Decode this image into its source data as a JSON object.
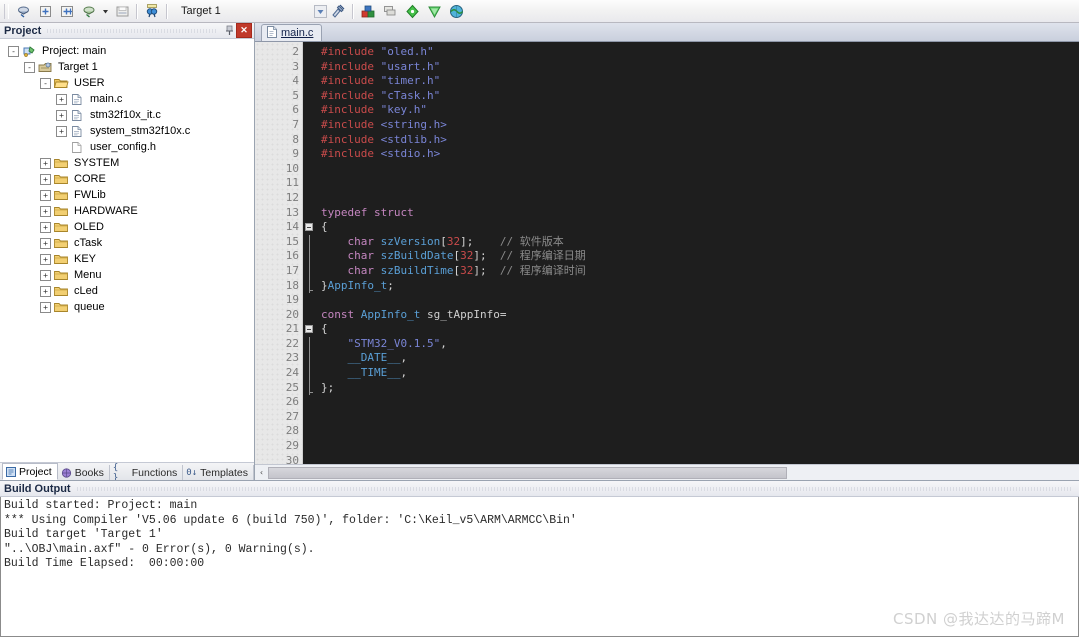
{
  "toolbar": {
    "buttons": [
      {
        "name": "new-file-icon",
        "title": "New"
      },
      {
        "name": "open-file-icon",
        "title": "Open"
      },
      {
        "name": "save-icon",
        "title": "Save"
      },
      {
        "name": "save-all-icon",
        "title": "Save All"
      },
      {
        "name": "print-icon",
        "title": "Print"
      },
      {
        "name": "translate-icon",
        "title": "Translate"
      }
    ],
    "target_value": "Target 1",
    "right_buttons": [
      {
        "name": "target-options-icon",
        "title": "Options for Target"
      },
      {
        "name": "build-icon",
        "title": "Build"
      },
      {
        "name": "rebuild-icon",
        "title": "Rebuild"
      },
      {
        "name": "debug-icon",
        "title": "Start/Stop Debug"
      },
      {
        "name": "bookmark-icon",
        "title": "Bookmark"
      },
      {
        "name": "manage-icon",
        "title": "Manage Run-Time Environment"
      }
    ]
  },
  "project_panel": {
    "title": "Project",
    "pin_label": "⇱",
    "close_label": "✕",
    "tree": [
      {
        "label": "Project: main",
        "indent": 0,
        "expander": "-",
        "icon": "project-icon"
      },
      {
        "label": "Target 1",
        "indent": 1,
        "expander": "-",
        "icon": "target-icon"
      },
      {
        "label": "USER",
        "indent": 2,
        "expander": "-",
        "icon": "folder-open-icon"
      },
      {
        "label": "main.c",
        "indent": 3,
        "expander": "+",
        "icon": "c-file-icon"
      },
      {
        "label": "stm32f10x_it.c",
        "indent": 3,
        "expander": "+",
        "icon": "c-file-icon"
      },
      {
        "label": "system_stm32f10x.c",
        "indent": 3,
        "expander": "+",
        "icon": "c-file-icon"
      },
      {
        "label": "user_config.h",
        "indent": 3,
        "expander": "",
        "icon": "h-file-icon"
      },
      {
        "label": "SYSTEM",
        "indent": 2,
        "expander": "+",
        "icon": "folder-icon"
      },
      {
        "label": "CORE",
        "indent": 2,
        "expander": "+",
        "icon": "folder-icon"
      },
      {
        "label": "FWLib",
        "indent": 2,
        "expander": "+",
        "icon": "folder-icon"
      },
      {
        "label": "HARDWARE",
        "indent": 2,
        "expander": "+",
        "icon": "folder-icon"
      },
      {
        "label": "OLED",
        "indent": 2,
        "expander": "+",
        "icon": "folder-icon"
      },
      {
        "label": "cTask",
        "indent": 2,
        "expander": "+",
        "icon": "folder-icon"
      },
      {
        "label": "KEY",
        "indent": 2,
        "expander": "+",
        "icon": "folder-icon"
      },
      {
        "label": "Menu",
        "indent": 2,
        "expander": "+",
        "icon": "folder-icon"
      },
      {
        "label": "cLed",
        "indent": 2,
        "expander": "+",
        "icon": "folder-icon"
      },
      {
        "label": "queue",
        "indent": 2,
        "expander": "+",
        "icon": "folder-icon"
      }
    ],
    "tabs": [
      {
        "label": "Project",
        "icon": "project-tab-icon",
        "active": true
      },
      {
        "label": "Books",
        "icon": "books-tab-icon",
        "active": false
      },
      {
        "label": "Functions",
        "icon": "functions-tab-icon",
        "active": false
      },
      {
        "label": "Templates",
        "icon": "templates-tab-icon",
        "active": false
      }
    ]
  },
  "editor": {
    "tab_label": "main.c",
    "tab_icon": "c-file-icon",
    "first_line_number": 2,
    "last_line_number": 30,
    "lines": [
      {
        "n": 2,
        "tokens": [
          {
            "t": "#include ",
            "c": "pre"
          },
          {
            "t": "\"oled.h\"",
            "c": "str"
          }
        ]
      },
      {
        "n": 3,
        "tokens": [
          {
            "t": "#include ",
            "c": "pre"
          },
          {
            "t": "\"usart.h\"",
            "c": "str"
          }
        ]
      },
      {
        "n": 4,
        "tokens": [
          {
            "t": "#include ",
            "c": "pre"
          },
          {
            "t": "\"timer.h\"",
            "c": "str"
          }
        ]
      },
      {
        "n": 5,
        "tokens": [
          {
            "t": "#include ",
            "c": "pre"
          },
          {
            "t": "\"cTask.h\"",
            "c": "str"
          }
        ]
      },
      {
        "n": 6,
        "tokens": [
          {
            "t": "#include ",
            "c": "pre"
          },
          {
            "t": "\"key.h\"",
            "c": "str"
          }
        ]
      },
      {
        "n": 7,
        "tokens": [
          {
            "t": "#include ",
            "c": "pre"
          },
          {
            "t": "<string.h>",
            "c": "str"
          }
        ]
      },
      {
        "n": 8,
        "tokens": [
          {
            "t": "#include ",
            "c": "pre"
          },
          {
            "t": "<stdlib.h>",
            "c": "str"
          }
        ]
      },
      {
        "n": 9,
        "tokens": [
          {
            "t": "#include ",
            "c": "pre"
          },
          {
            "t": "<stdio.h>",
            "c": "str"
          }
        ]
      },
      {
        "n": 10,
        "tokens": []
      },
      {
        "n": 11,
        "tokens": []
      },
      {
        "n": 12,
        "tokens": []
      },
      {
        "n": 13,
        "tokens": [
          {
            "t": "typedef struct",
            "c": "kw"
          }
        ]
      },
      {
        "n": 14,
        "tokens": [
          {
            "t": "{",
            "c": "punc"
          }
        ],
        "fold": "start"
      },
      {
        "n": 15,
        "tokens": [
          {
            "t": "    ",
            "c": "punc"
          },
          {
            "t": "char",
            "c": "kw"
          },
          {
            "t": " ",
            "c": "punc"
          },
          {
            "t": "szVersion",
            "c": "type"
          },
          {
            "t": "[",
            "c": "punc"
          },
          {
            "t": "32",
            "c": "num"
          },
          {
            "t": "];",
            "c": "punc"
          },
          {
            "t": "    ",
            "c": "punc"
          },
          {
            "t": "// 软件版本",
            "c": "cmt"
          }
        ],
        "fold": "mid"
      },
      {
        "n": 16,
        "tokens": [
          {
            "t": "    ",
            "c": "punc"
          },
          {
            "t": "char",
            "c": "kw"
          },
          {
            "t": " ",
            "c": "punc"
          },
          {
            "t": "szBuildDate",
            "c": "type"
          },
          {
            "t": "[",
            "c": "punc"
          },
          {
            "t": "32",
            "c": "num"
          },
          {
            "t": "];",
            "c": "punc"
          },
          {
            "t": "  ",
            "c": "punc"
          },
          {
            "t": "// 程序编译日期",
            "c": "cmt"
          }
        ],
        "fold": "mid"
      },
      {
        "n": 17,
        "tokens": [
          {
            "t": "    ",
            "c": "punc"
          },
          {
            "t": "char",
            "c": "kw"
          },
          {
            "t": " ",
            "c": "punc"
          },
          {
            "t": "szBuildTime",
            "c": "type"
          },
          {
            "t": "[",
            "c": "punc"
          },
          {
            "t": "32",
            "c": "num"
          },
          {
            "t": "];",
            "c": "punc"
          },
          {
            "t": "  ",
            "c": "punc"
          },
          {
            "t": "// 程序编译时间",
            "c": "cmt"
          }
        ],
        "fold": "mid"
      },
      {
        "n": 18,
        "tokens": [
          {
            "t": "}",
            "c": "punc"
          },
          {
            "t": "AppInfo_t",
            "c": "type"
          },
          {
            "t": ";",
            "c": "punc"
          }
        ],
        "fold": "end"
      },
      {
        "n": 19,
        "tokens": []
      },
      {
        "n": 20,
        "tokens": [
          {
            "t": "const",
            "c": "kw"
          },
          {
            "t": " ",
            "c": "punc"
          },
          {
            "t": "AppInfo_t",
            "c": "type"
          },
          {
            "t": " ",
            "c": "punc"
          },
          {
            "t": "sg_tAppInfo",
            "c": "var"
          },
          {
            "t": "=",
            "c": "punc"
          }
        ]
      },
      {
        "n": 21,
        "tokens": [
          {
            "t": "{",
            "c": "punc"
          }
        ],
        "fold": "start"
      },
      {
        "n": 22,
        "tokens": [
          {
            "t": "    ",
            "c": "punc"
          },
          {
            "t": "\"STM32_V0.1.5\"",
            "c": "str"
          },
          {
            "t": ",",
            "c": "punc"
          }
        ],
        "fold": "mid"
      },
      {
        "n": 23,
        "tokens": [
          {
            "t": "    ",
            "c": "punc"
          },
          {
            "t": "__DATE__",
            "c": "type"
          },
          {
            "t": ",",
            "c": "punc"
          }
        ],
        "fold": "mid"
      },
      {
        "n": 24,
        "tokens": [
          {
            "t": "    ",
            "c": "punc"
          },
          {
            "t": "__TIME__",
            "c": "type"
          },
          {
            "t": ",",
            "c": "punc"
          }
        ],
        "fold": "mid"
      },
      {
        "n": 25,
        "tokens": [
          {
            "t": "};",
            "c": "punc"
          }
        ],
        "fold": "end"
      },
      {
        "n": 26,
        "tokens": []
      },
      {
        "n": 27,
        "tokens": []
      },
      {
        "n": 28,
        "tokens": []
      },
      {
        "n": 29,
        "tokens": []
      },
      {
        "n": 30,
        "tokens": []
      }
    ],
    "hscroll": {
      "left_arrow": "‹",
      "right_arrow": "›",
      "thumb_percent": 63
    }
  },
  "build_output": {
    "title": "Build Output",
    "lines": [
      "Build started: Project: main",
      "*** Using Compiler 'V5.06 update 6 (build 750)', folder: 'C:\\Keil_v5\\ARM\\ARMCC\\Bin'",
      "Build target 'Target 1'",
      "\"..\\OBJ\\main.axf\" - 0 Error(s), 0 Warning(s).",
      "Build Time Elapsed:  00:00:00"
    ]
  },
  "watermark": "CSDN @我达达的马蹄M"
}
